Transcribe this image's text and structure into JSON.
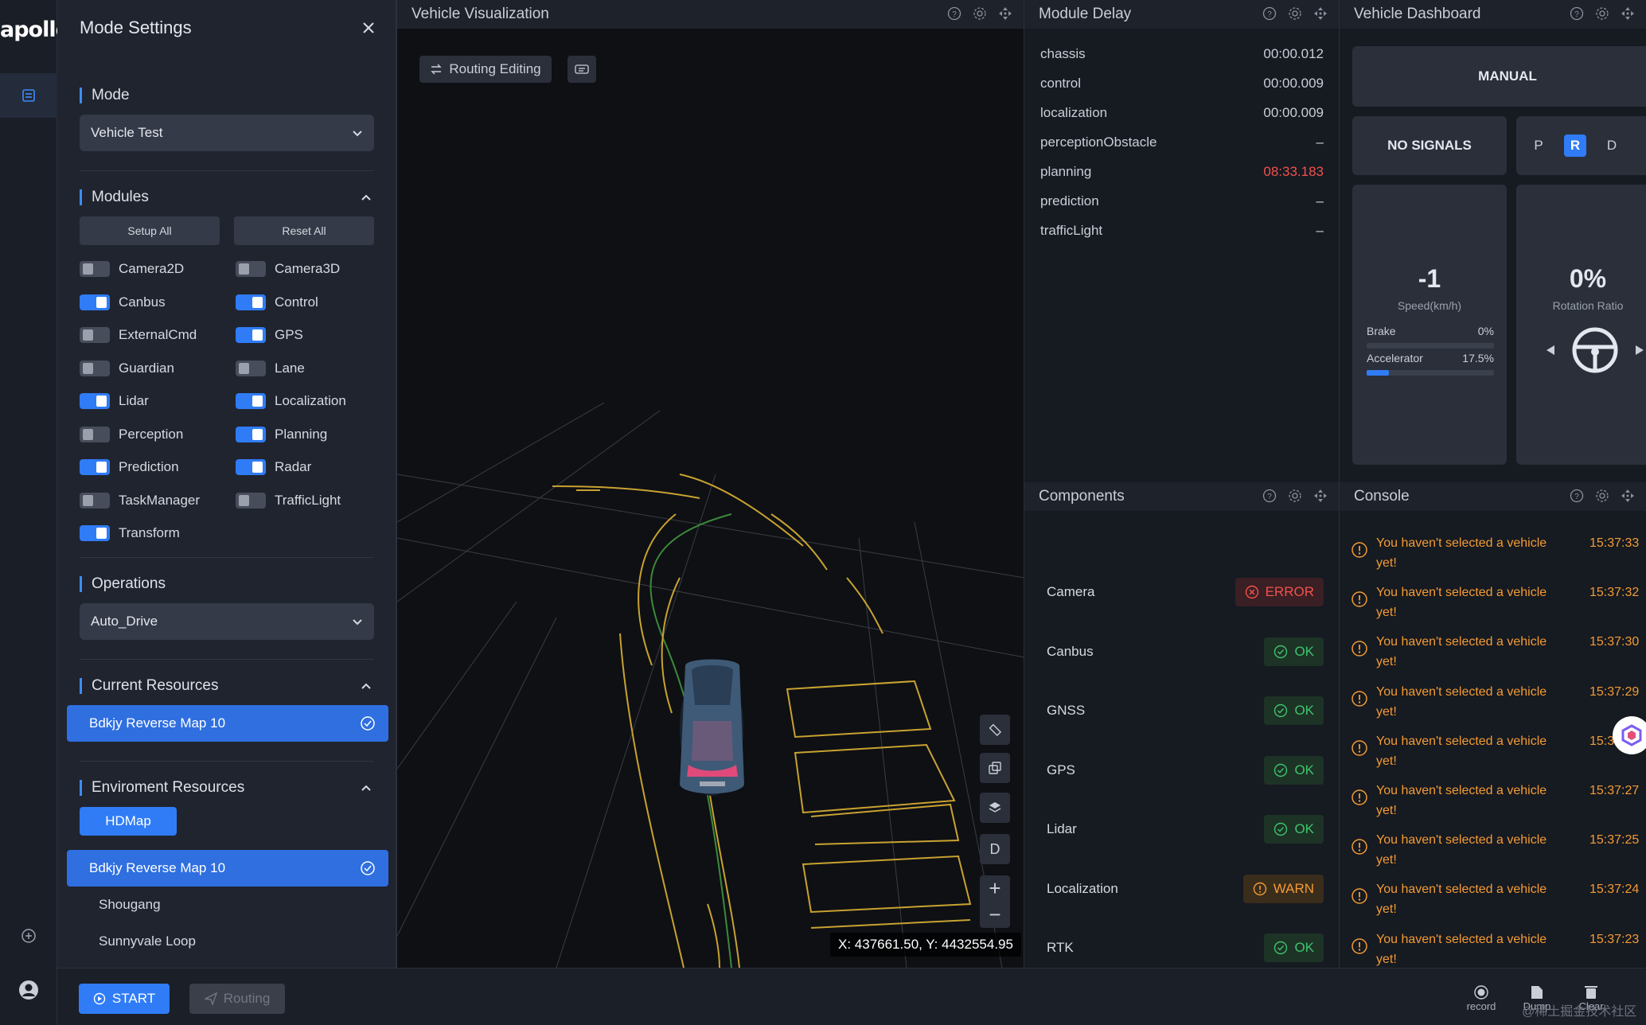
{
  "app": {
    "logo": "apollo"
  },
  "settings": {
    "title": "Mode Settings",
    "mode": {
      "label": "Mode",
      "value": "Vehicle Test"
    },
    "modules": {
      "label": "Modules",
      "setup_all": "Setup All",
      "reset_all": "Reset All",
      "items": [
        {
          "name": "Camera2D",
          "on": false
        },
        {
          "name": "Camera3D",
          "on": false
        },
        {
          "name": "Canbus",
          "on": true
        },
        {
          "name": "Control",
          "on": true
        },
        {
          "name": "ExternalCmd",
          "on": false
        },
        {
          "name": "GPS",
          "on": true
        },
        {
          "name": "Guardian",
          "on": false
        },
        {
          "name": "Lane",
          "on": false
        },
        {
          "name": "Lidar",
          "on": true
        },
        {
          "name": "Localization",
          "on": true
        },
        {
          "name": "Perception",
          "on": false
        },
        {
          "name": "Planning",
          "on": true
        },
        {
          "name": "Prediction",
          "on": true
        },
        {
          "name": "Radar",
          "on": true
        },
        {
          "name": "TaskManager",
          "on": false
        },
        {
          "name": "TrafficLight",
          "on": false
        },
        {
          "name": "Transform",
          "on": true
        }
      ]
    },
    "operations": {
      "label": "Operations",
      "value": "Auto_Drive"
    },
    "current_resources": {
      "label": "Current Resources",
      "selected": "Bdkjy Reverse Map 10"
    },
    "environment_resources": {
      "label": "Enviroment Resources",
      "tab": "HDMap",
      "items": [
        "Bdkjy Reverse Map 10",
        "Shougang",
        "Sunnyvale Loop"
      ],
      "selected_index": 0
    }
  },
  "bottom": {
    "start": "START",
    "routing": "Routing",
    "record": "record",
    "dump": "Dump",
    "clear": "Clear",
    "watermark": "@稀土掘金技术社区"
  },
  "viz": {
    "title": "Vehicle Visualization",
    "routing_editing": "Routing Editing",
    "drive_mode_key": "D",
    "coords": "X: 437661.50, Y: 4432554.95"
  },
  "delay": {
    "title": "Module Delay",
    "rows": [
      {
        "name": "chassis",
        "value": "00:00.012",
        "hot": false
      },
      {
        "name": "control",
        "value": "00:00.009",
        "hot": false
      },
      {
        "name": "localization",
        "value": "00:00.009",
        "hot": false
      },
      {
        "name": "perceptionObstacle",
        "value": "–",
        "hot": false
      },
      {
        "name": "planning",
        "value": "08:33.183",
        "hot": true
      },
      {
        "name": "prediction",
        "value": "–",
        "hot": false
      },
      {
        "name": "trafficLight",
        "value": "–",
        "hot": false
      }
    ]
  },
  "dash": {
    "title": "Vehicle Dashboard",
    "mode": "MANUAL",
    "signals": "NO SIGNALS",
    "gears": [
      "P",
      "R",
      "D"
    ],
    "active_gear": "R",
    "speed": {
      "value": "-1",
      "label": "Speed(km/h)"
    },
    "brake": {
      "label": "Brake",
      "text": "0%",
      "fraction": 0.0
    },
    "accelerator": {
      "label": "Accelerator",
      "text": "17.5%",
      "fraction": 0.175
    },
    "rotation": {
      "value": "0%",
      "label": "Rotation Ratio"
    }
  },
  "components": {
    "title": "Components",
    "rows": [
      {
        "name": "Camera",
        "status": "ERROR",
        "kind": "error"
      },
      {
        "name": "Canbus",
        "status": "OK",
        "kind": "ok"
      },
      {
        "name": "GNSS",
        "status": "OK",
        "kind": "ok"
      },
      {
        "name": "GPS",
        "status": "OK",
        "kind": "ok"
      },
      {
        "name": "Lidar",
        "status": "OK",
        "kind": "ok"
      },
      {
        "name": "Localization",
        "status": "WARN",
        "kind": "warn"
      },
      {
        "name": "RTK",
        "status": "OK",
        "kind": "ok"
      }
    ]
  },
  "console": {
    "title": "Console",
    "logs": [
      {
        "msg": "You haven't selected a vehicle yet!",
        "time": "15:37:33"
      },
      {
        "msg": "You haven't selected a vehicle yet!",
        "time": "15:37:32"
      },
      {
        "msg": "You haven't selected a vehicle yet!",
        "time": "15:37:30"
      },
      {
        "msg": "You haven't selected a vehicle yet!",
        "time": "15:37:29"
      },
      {
        "msg": "You haven't selected a vehicle yet!",
        "time": "15:3"
      },
      {
        "msg": "You haven't selected a vehicle yet!",
        "time": "15:37:27"
      },
      {
        "msg": "You haven't selected a vehicle yet!",
        "time": "15:37:25"
      },
      {
        "msg": "You haven't selected a vehicle yet!",
        "time": "15:37:24"
      },
      {
        "msg": "You haven't selected a vehicle yet!",
        "time": "15:37:23"
      }
    ]
  },
  "colors": {
    "accent": "#2f7cf6",
    "ok": "#3ec46d",
    "error": "#f0524d",
    "warn": "#f39b34"
  }
}
